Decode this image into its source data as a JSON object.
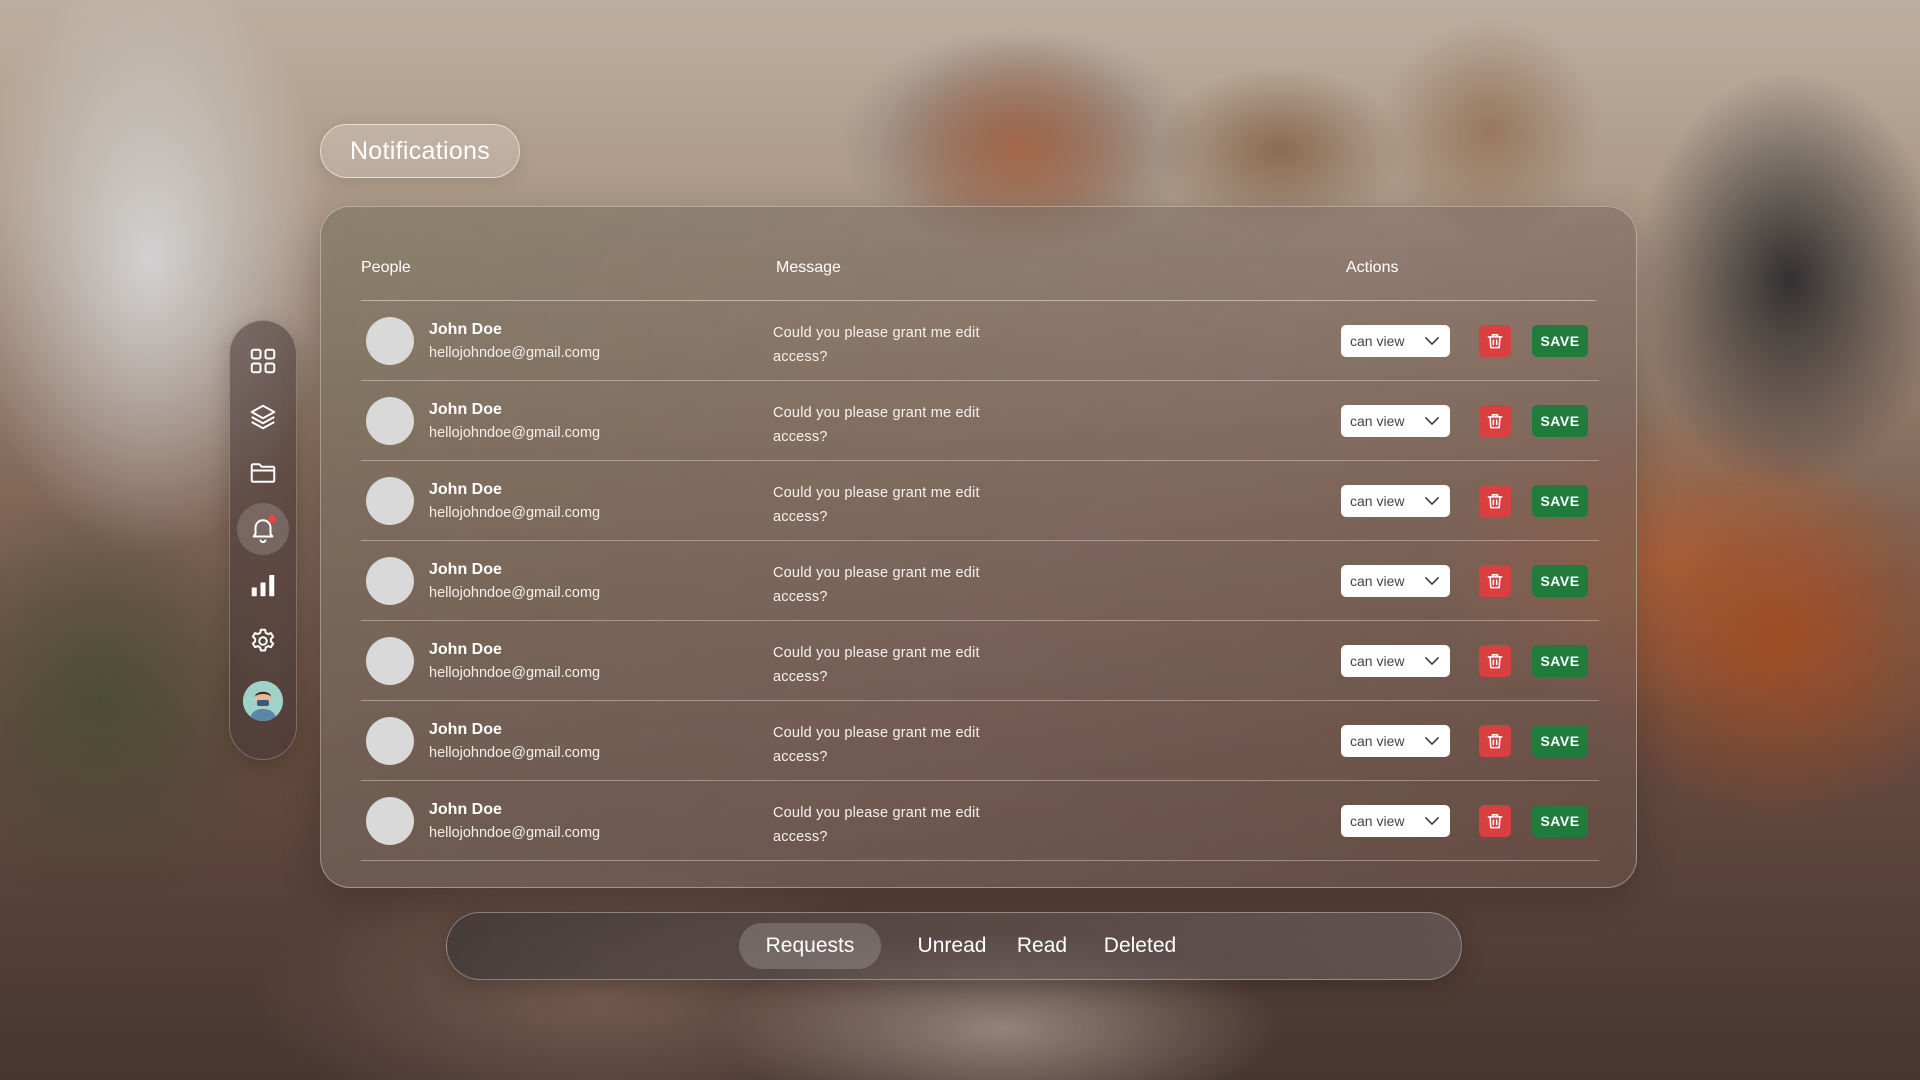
{
  "page": {
    "title": "Notifications"
  },
  "sidebar": {
    "items": [
      {
        "icon": "grid-icon",
        "active": false
      },
      {
        "icon": "layers-icon",
        "active": false
      },
      {
        "icon": "folder-icon",
        "active": false
      },
      {
        "icon": "bell-icon",
        "active": true,
        "has_unread_dot": true
      },
      {
        "icon": "bar-chart-icon",
        "active": false
      },
      {
        "icon": "settings-icon",
        "active": false
      }
    ],
    "avatar": "user-avatar"
  },
  "table": {
    "headers": {
      "people": "People",
      "message": "Message",
      "actions": "Actions"
    },
    "rows": [
      {
        "name": "John Doe",
        "email": "hellojohndoe@gmail.comg",
        "message": "Could you please grant me edit access?",
        "permission": "can view",
        "save_label": "SAVE"
      },
      {
        "name": "John Doe",
        "email": "hellojohndoe@gmail.comg",
        "message": "Could you please grant me edit access?",
        "permission": "can view",
        "save_label": "SAVE"
      },
      {
        "name": "John Doe",
        "email": "hellojohndoe@gmail.comg",
        "message": "Could you please grant me edit access?",
        "permission": "can view",
        "save_label": "SAVE"
      },
      {
        "name": "John Doe",
        "email": "hellojohndoe@gmail.comg",
        "message": "Could you please grant me edit access?",
        "permission": "can view",
        "save_label": "SAVE"
      },
      {
        "name": "John Doe",
        "email": "hellojohndoe@gmail.comg",
        "message": "Could you please grant me edit access?",
        "permission": "can view",
        "save_label": "SAVE"
      },
      {
        "name": "John Doe",
        "email": "hellojohndoe@gmail.comg",
        "message": "Could you please grant me edit access?",
        "permission": "can view",
        "save_label": "SAVE"
      },
      {
        "name": "John Doe",
        "email": "hellojohndoe@gmail.comg",
        "message": "Could you please grant me edit access?",
        "permission": "can view",
        "save_label": "SAVE"
      }
    ]
  },
  "tabs": [
    {
      "label": "Requests",
      "active": true
    },
    {
      "label": "Unread",
      "active": false
    },
    {
      "label": "Read",
      "active": false
    },
    {
      "label": "Deleted",
      "active": false
    }
  ],
  "colors": {
    "delete": "#d84040",
    "save": "#1f7c3a",
    "notification_dot": "#e8453c"
  }
}
